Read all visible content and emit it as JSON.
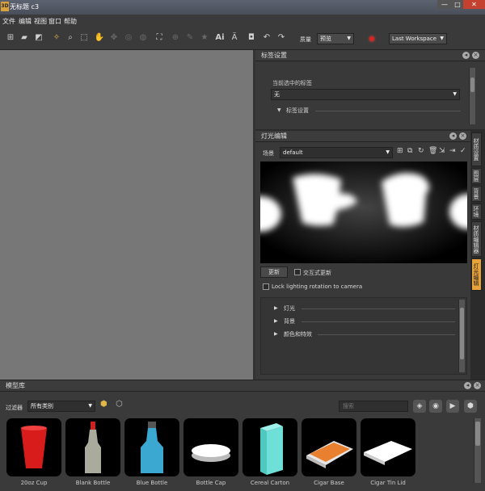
{
  "window": {
    "title": "无标题 c3",
    "app_icon": "3D",
    "minimize": "—",
    "maximize": "□",
    "close": "✕"
  },
  "menu": [
    "文件",
    "编辑",
    "视图",
    "窗口",
    "帮助"
  ],
  "toolbar": {
    "quality_label": "质量",
    "quality_value": "预览",
    "workspace": "Last Workspace"
  },
  "label_panel": {
    "title": "标签设置",
    "current_label_heading": "当前选中的标签",
    "current_value": "无",
    "section": "标签设置"
  },
  "light_panel": {
    "title": "灯光编辑",
    "scene_label": "场景",
    "scene_value": "default",
    "update_button": "更新",
    "interactive_update": "交互式更新",
    "lock_rotation": "Lock lighting rotation to camera",
    "sections": [
      "灯光",
      "背景",
      "颜色和特效"
    ]
  },
  "side_tabs": [
    "材质设置",
    "图层",
    "背景",
    "环境",
    "材质编辑器",
    "灯光编辑"
  ],
  "model_library": {
    "title": "模型库",
    "filter_label": "过滤器",
    "filter_value": "所有类别",
    "search_placeholder": "搜索",
    "items": [
      {
        "name": "20oz Cup"
      },
      {
        "name": "Blank Bottle"
      },
      {
        "name": "Blue Bottle"
      },
      {
        "name": "Bottle Cap"
      },
      {
        "name": "Cereal Carton"
      },
      {
        "name": "Cigar Base"
      },
      {
        "name": "Cigar Tin Lid"
      }
    ]
  },
  "colors": {
    "active_tab": "#e8a23a",
    "viewport": "#777777",
    "panel": "#393939"
  }
}
